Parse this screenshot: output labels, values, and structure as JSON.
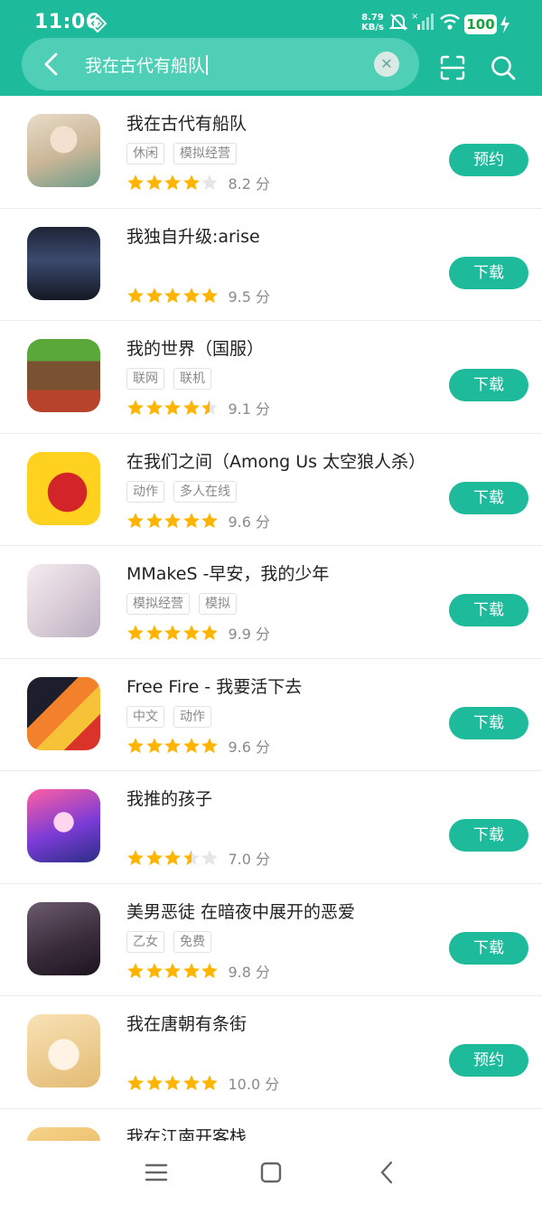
{
  "status": {
    "time": "11:06",
    "speed_top": "8.79",
    "speed_bottom": "KB/s",
    "battery": "100"
  },
  "search": {
    "query": "我在古代有船队"
  },
  "icons": {
    "back": "arrow-left-icon",
    "clear": "close-icon",
    "scan": "scan-icon",
    "search": "search-icon"
  },
  "results": [
    {
      "title": "我在古代有船队",
      "tags": [
        "休闲",
        "模拟经营"
      ],
      "stars": 4,
      "score": "8.2 分",
      "action": "预约"
    },
    {
      "title": "我独自升级:arise",
      "tags": [],
      "stars": 5,
      "score": "9.5 分",
      "action": "下载"
    },
    {
      "title": "我的世界（国服）",
      "tags": [
        "联网",
        "联机"
      ],
      "stars": 4.5,
      "score": "9.1 分",
      "action": "下载"
    },
    {
      "title": "在我们之间（Among Us 太空狼人杀）",
      "tags": [
        "动作",
        "多人在线"
      ],
      "stars": 5,
      "score": "9.6 分",
      "action": "下载"
    },
    {
      "title": "MMakeS -早安，我的少年",
      "tags": [
        "模拟经营",
        "模拟"
      ],
      "stars": 5,
      "score": "9.9 分",
      "action": "下载"
    },
    {
      "title": "Free Fire - 我要活下去",
      "tags": [
        "中文",
        "动作"
      ],
      "stars": 5,
      "score": "9.6 分",
      "action": "下载"
    },
    {
      "title": "我推的孩子",
      "tags": [],
      "stars": 3.5,
      "score": "7.0 分",
      "action": "下载"
    },
    {
      "title": "美男恶徒 在暗夜中展开的恶爱",
      "tags": [
        "乙女",
        "免费"
      ],
      "stars": 5,
      "score": "9.8 分",
      "action": "下载"
    },
    {
      "title": "我在唐朝有条街",
      "tags": [],
      "stars": 5,
      "score": "10.0 分",
      "action": "预约"
    },
    {
      "title": "我在江南开客栈",
      "tags": [],
      "stars": 0,
      "score": "",
      "action": ""
    }
  ],
  "colors": {
    "accent": "#1dbb9c",
    "star": "#ffb400",
    "star_empty": "#e6e6e6"
  }
}
